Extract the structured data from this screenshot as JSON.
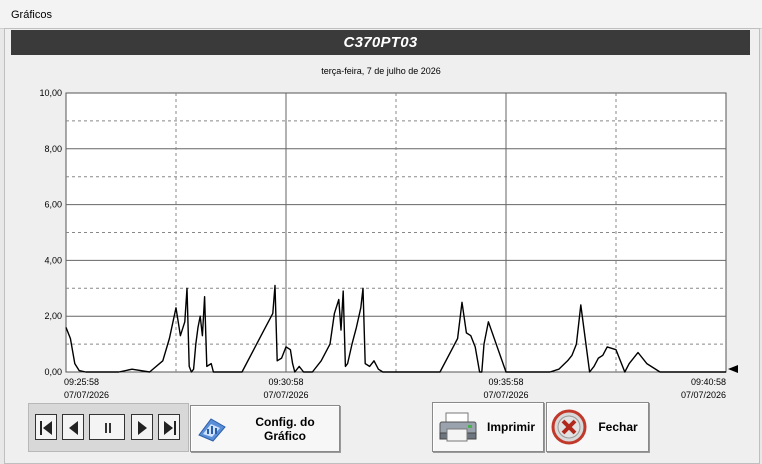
{
  "window": {
    "title": "Gráficos"
  },
  "header": {
    "title": "C370PT03"
  },
  "chart_data": {
    "type": "line",
    "date_label": "terça-feira, 7 de julho de 2026",
    "ylim": [
      0,
      10
    ],
    "yticks": [
      "10,00",
      "8,00",
      "6,00",
      "4,00",
      "2,00",
      "0,00"
    ],
    "xticks": [
      {
        "time": "09:25:58",
        "date": "07/07/2026"
      },
      {
        "time": "09:30:58",
        "date": "07/07/2026"
      },
      {
        "time": "09:35:58",
        "date": "07/07/2026"
      },
      {
        "time": "09:40:58",
        "date": "07/07/2026"
      }
    ],
    "xlim_minutes": [
      0,
      15
    ],
    "grid": true,
    "series": [
      {
        "color": "#000000",
        "x": [
          0,
          0.1,
          0.2,
          0.3,
          0.45,
          0.8,
          1.2,
          1.5,
          1.9,
          2.2,
          2.35,
          2.5,
          2.6,
          2.7,
          2.75,
          2.8,
          2.85,
          2.9,
          2.95,
          3.0,
          3.05,
          3.1,
          3.15,
          3.2,
          3.3,
          3.35,
          3.5,
          4.0,
          4.5,
          4.7,
          4.75,
          4.8,
          4.9,
          5.0,
          5.1,
          5.15,
          5.2,
          5.3,
          5.4,
          5.45,
          5.6,
          5.8,
          6.0,
          6.1,
          6.2,
          6.25,
          6.3,
          6.35,
          6.4,
          6.5,
          6.6,
          6.7,
          6.75,
          6.8,
          6.9,
          7.0,
          7.1,
          7.2,
          7.5,
          8.0,
          8.5,
          8.8,
          8.9,
          9.0,
          9.1,
          9.2,
          9.3,
          9.4,
          9.45,
          9.5,
          9.6,
          10.0,
          10.5,
          11.0,
          11.2,
          11.4,
          11.5,
          11.6,
          11.7,
          11.8,
          11.9,
          12.0,
          12.1,
          12.2,
          12.3,
          12.5,
          12.7,
          12.8,
          12.9,
          13.0,
          13.2,
          13.5,
          14.0,
          14.5,
          14.7,
          14.9,
          15.0
        ],
        "y": [
          1.6,
          1.2,
          0.3,
          0.05,
          0.0,
          0.0,
          0.0,
          0.1,
          0.0,
          0.4,
          1.2,
          2.3,
          1.3,
          1.8,
          3.0,
          0.2,
          0.0,
          0.1,
          1.0,
          1.6,
          2.0,
          1.3,
          2.7,
          0.2,
          0.3,
          0.0,
          0.0,
          0.0,
          1.5,
          2.1,
          3.1,
          0.4,
          0.5,
          0.9,
          0.8,
          0.3,
          0.0,
          0.2,
          0.0,
          0.0,
          0.0,
          0.4,
          1.0,
          2.1,
          2.6,
          1.5,
          2.9,
          0.2,
          0.3,
          1.0,
          1.6,
          2.3,
          3.0,
          0.3,
          0.2,
          0.4,
          0.1,
          0.0,
          0.0,
          0.0,
          0.0,
          0.9,
          1.2,
          2.5,
          1.4,
          1.3,
          0.9,
          0.0,
          0.0,
          1.0,
          1.8,
          0.0,
          0.0,
          0.0,
          0.1,
          0.4,
          0.6,
          1.0,
          2.4,
          1.2,
          0.0,
          0.2,
          0.5,
          0.6,
          0.9,
          0.8,
          0.0,
          0.3,
          0.5,
          0.7,
          0.3,
          0.0,
          0.0,
          0.0,
          0.0,
          0.0,
          0.0
        ]
      }
    ]
  },
  "buttons": {
    "config_label_line1": "Config. do",
    "config_label_line2": "Gráfico",
    "print_label": "Imprimir",
    "close_label": "Fechar"
  },
  "icons": {
    "first": "skip-first-icon",
    "prev": "previous-icon",
    "pause": "pause-icon",
    "next": "next-icon",
    "last": "skip-last-icon",
    "config": "chart-config-icon",
    "print": "printer-icon",
    "close": "close-x-icon"
  }
}
